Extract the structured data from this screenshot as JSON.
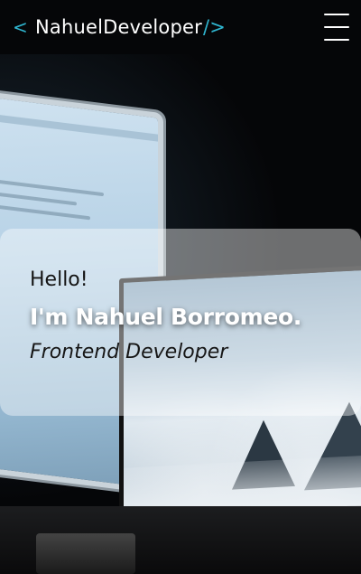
{
  "header": {
    "logo_open": "<",
    "logo_name": "NahuelDeveloper",
    "logo_close": "/>",
    "menu_icon": "hamburger-menu-icon",
    "accent_color": "#2fb5cf"
  },
  "hero": {
    "greeting": "Hello!",
    "name": "I'm Nahuel Borromeo.",
    "role": "Frontend Developer"
  }
}
